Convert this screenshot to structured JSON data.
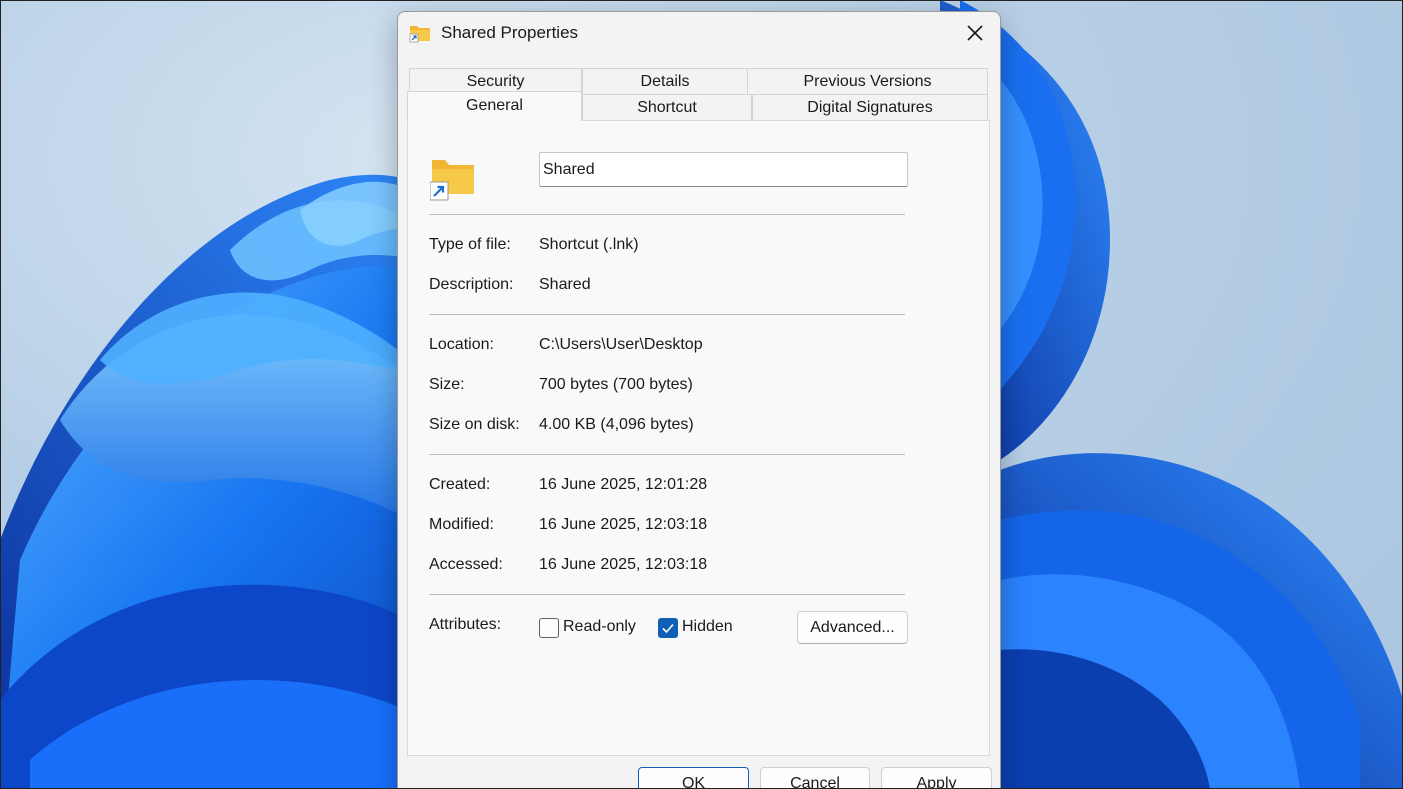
{
  "dialog": {
    "title": "Shared Properties",
    "tabs_row1": [
      {
        "label": "Security"
      },
      {
        "label": "Details"
      },
      {
        "label": "Previous Versions"
      }
    ],
    "tabs_row2": [
      {
        "label": "General",
        "active": true
      },
      {
        "label": "Shortcut"
      },
      {
        "label": "Digital Signatures"
      }
    ],
    "general": {
      "name_value": "Shared",
      "fields": {
        "type_label": "Type of file:",
        "type_value": "Shortcut (.lnk)",
        "description_label": "Description:",
        "description_value": "Shared",
        "location_label": "Location:",
        "location_value": "C:\\Users\\User\\Desktop",
        "size_label": "Size:",
        "size_value": "700 bytes (700 bytes)",
        "size_on_disk_label": "Size on disk:",
        "size_on_disk_value": "4.00 KB (4,096 bytes)",
        "created_label": "Created:",
        "created_value": "16 June 2025, 12:01:28",
        "modified_label": "Modified:",
        "modified_value": "16 June 2025, 12:03:18",
        "accessed_label": "Accessed:",
        "accessed_value": "16 June 2025, 12:03:18"
      },
      "attributes": {
        "label": "Attributes:",
        "readonly_label": "Read-only",
        "readonly_checked": false,
        "hidden_label": "Hidden",
        "hidden_checked": true,
        "advanced_label": "Advanced..."
      }
    },
    "buttons": {
      "ok": "OK",
      "cancel": "Cancel",
      "apply": "Apply"
    }
  },
  "icons": {
    "title": "folder-shortcut-icon",
    "close": "close-icon",
    "folder": "folder-shortcut-icon",
    "check": "checkmark-icon"
  },
  "colors": {
    "accent": "#0f5fb6",
    "annotation_arrow": "#ef4036",
    "folder": "#f7c948"
  }
}
